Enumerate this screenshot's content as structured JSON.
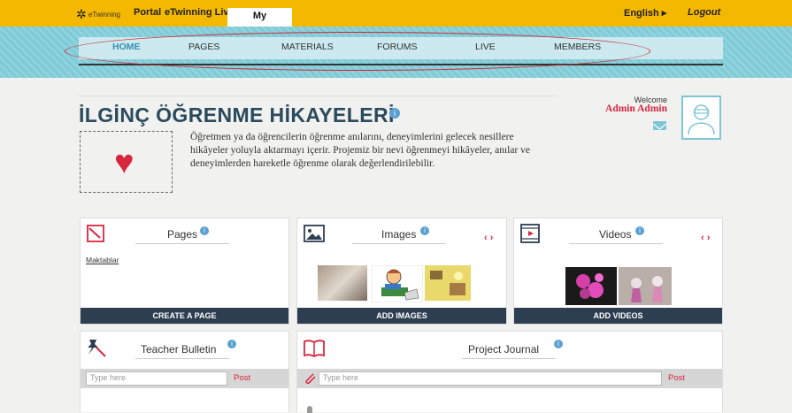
{
  "topbar": {
    "logo_text": "eTwinning",
    "portal": "Portal",
    "etwinning_live": "eTwinning Live",
    "my_twinspaces": "My TwinSpaces",
    "language": "English ▸",
    "logout": "Logout"
  },
  "nav": {
    "items": [
      {
        "label": "HOME"
      },
      {
        "label": "PAGES"
      },
      {
        "label": "MATERIALS"
      },
      {
        "label": "FORUMS"
      },
      {
        "label": "LIVE"
      },
      {
        "label": "MEMBERS"
      }
    ]
  },
  "project": {
    "title": "İLGİNÇ ÖĞRENME HİKAYELERİ",
    "description": "Öğretmen ya da öğrencilerin öğrenme anılarını, deneyimlerini gelecek nesillere hikâyeler yoluyla aktarmayı içerir. Projemiz bir nevi öğrenmeyi hikâyeler, anılar ve deneyimlerden hareketle öğrenme olarak değerlendirilebilir."
  },
  "user": {
    "welcome": "Welcome",
    "name": "Admin Admin"
  },
  "cards": {
    "pages": {
      "title": "Pages",
      "item": "Maktablar",
      "button": "CREATE A PAGE"
    },
    "images": {
      "title": "Images",
      "button": "ADD IMAGES",
      "arrows": "‹ ›"
    },
    "videos": {
      "title": "Videos",
      "button": "ADD VIDEOS",
      "arrows": "‹ ›"
    },
    "bulletin": {
      "title": "Teacher Bulletin",
      "placeholder": "Type here",
      "post": "Post"
    },
    "journal": {
      "title": "Project Journal",
      "placeholder": "Type here",
      "post": "Post"
    }
  },
  "colors": {
    "topbar": "#f5b800",
    "accent": "#d8263f",
    "nav_active": "#3a8fb7",
    "button_dark": "#2c3e50"
  }
}
